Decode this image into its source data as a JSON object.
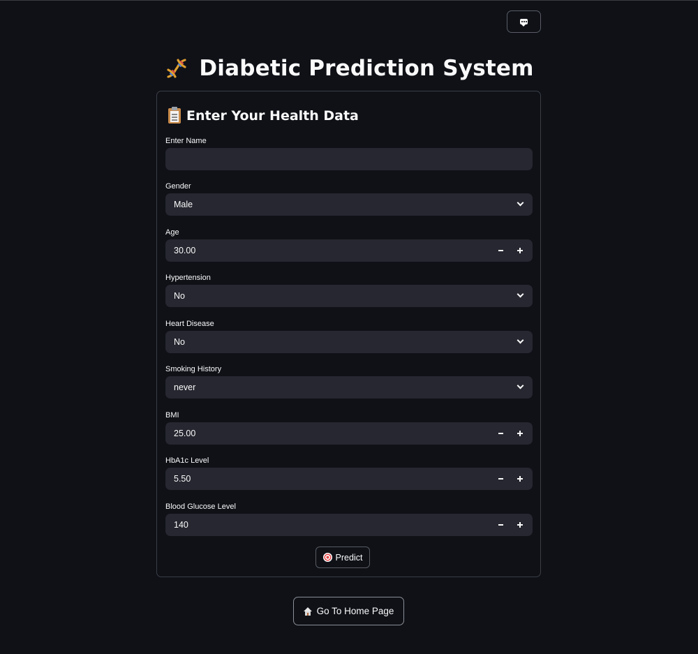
{
  "app": {
    "title": "Diabetic Prediction System",
    "title_icon": "dna-icon",
    "top_button_icon": "chat-icon"
  },
  "form": {
    "heading": "Enter Your Health Data",
    "heading_icon": "clipboard-icon",
    "fields": {
      "name": {
        "label": "Enter Name",
        "value": "",
        "placeholder": ""
      },
      "gender": {
        "label": "Gender",
        "value": "Male"
      },
      "age": {
        "label": "Age",
        "value": "30.00"
      },
      "hypertension": {
        "label": "Hypertension",
        "value": "No"
      },
      "heart_disease": {
        "label": "Heart Disease",
        "value": "No"
      },
      "smoking_history": {
        "label": "Smoking History",
        "value": "never"
      },
      "bmi": {
        "label": "BMI",
        "value": "25.00"
      },
      "hba1c": {
        "label": "HbA1c Level",
        "value": "5.50"
      },
      "glucose": {
        "label": "Blood Glucose Level",
        "value": "140"
      }
    },
    "predict_label": "Predict",
    "predict_icon": "target-icon"
  },
  "footer": {
    "home_label": "Go To Home Page",
    "home_icon": "house-icon"
  },
  "colors": {
    "background": "#0f1117",
    "input_background": "#262730",
    "text": "#fafafa",
    "border": "#3c3f48"
  }
}
